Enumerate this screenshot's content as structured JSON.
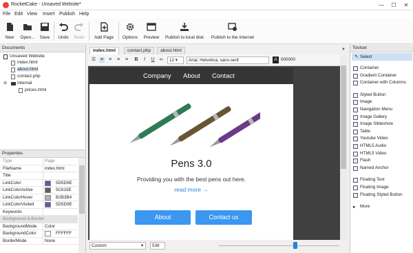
{
  "window": {
    "title": "RocketCake - Unsaved Website*",
    "minimize": "—",
    "maximize": "☐",
    "close": "✕"
  },
  "menu": [
    "File",
    "Edit",
    "View",
    "Insert",
    "Publish",
    "Help"
  ],
  "toolbar": {
    "new": "New",
    "open": "Open...",
    "save": "Save",
    "undo": "Undo",
    "redo": "Redo",
    "add_page": "Add Page",
    "options": "Options",
    "preview": "Preview",
    "publish_local": "Publish to local disk",
    "publish_internet": "Publish to the Internet"
  },
  "documents": {
    "title": "Documents",
    "root": "Unsaved Website",
    "files": [
      "index.html",
      "about.html",
      "contact.php"
    ],
    "folder": "internal",
    "folder_files": [
      "prices.html"
    ]
  },
  "properties": {
    "title": "Properties",
    "header": {
      "key": "Type",
      "value": "Page"
    },
    "rows": [
      {
        "key": "FileName",
        "value": "index.html"
      },
      {
        "key": "Title",
        "value": ""
      },
      {
        "key": "LinkColor",
        "value": "5D5D9E",
        "swatch": "#5d5d9e"
      },
      {
        "key": "LinkColorActive",
        "value": "5C615E",
        "swatch": "#5c615e"
      },
      {
        "key": "LinkColorHover",
        "value": "B2B3B4",
        "swatch": "#b2b3b4"
      },
      {
        "key": "LinkColorVisited",
        "value": "5D5D9E",
        "swatch": "#5d5d9e"
      },
      {
        "key": "Keywords",
        "value": ""
      }
    ],
    "section": "Background & Border",
    "rows2": [
      {
        "key": "BackgroundMode",
        "value": "Color"
      },
      {
        "key": "BackgroundColor",
        "value": "FFFFFF",
        "swatch": "#ffffff"
      },
      {
        "key": "BorderMode",
        "value": "None"
      }
    ]
  },
  "tabs": [
    "index.html",
    "contact.php",
    "about.html"
  ],
  "format": {
    "size": "12",
    "font": "Arial, Helvetica, sans-serif",
    "color_label": "A",
    "color": "000000"
  },
  "page": {
    "nav": [
      "Company",
      "About",
      "Contact"
    ],
    "title": "Pens 3.0",
    "subtitle": "Providing you with the best pens out here.",
    "read_more": "read more →",
    "buttons": [
      "About",
      "Contact us"
    ]
  },
  "status": {
    "preset": "Custom",
    "width": "538"
  },
  "toolset": {
    "title": "Toolset",
    "select": "Select",
    "groups": [
      [
        "Container",
        "Gradient Container",
        "Container with Columns"
      ],
      [
        "Styled Button",
        "Image",
        "Navigation Menu",
        "Image Gallery",
        "Image Slideshow",
        "Table",
        "Youtube Video",
        "HTML5 Audio",
        "HTML5 Video",
        "Flash",
        "Named Anchor"
      ],
      [
        "Floating Text",
        "Floating Image",
        "Floating Styled Button"
      ],
      [
        "More"
      ]
    ]
  },
  "colors": {
    "accent": "#3b97ef",
    "nav_bg": "#353535",
    "link": "#2b87d9"
  }
}
